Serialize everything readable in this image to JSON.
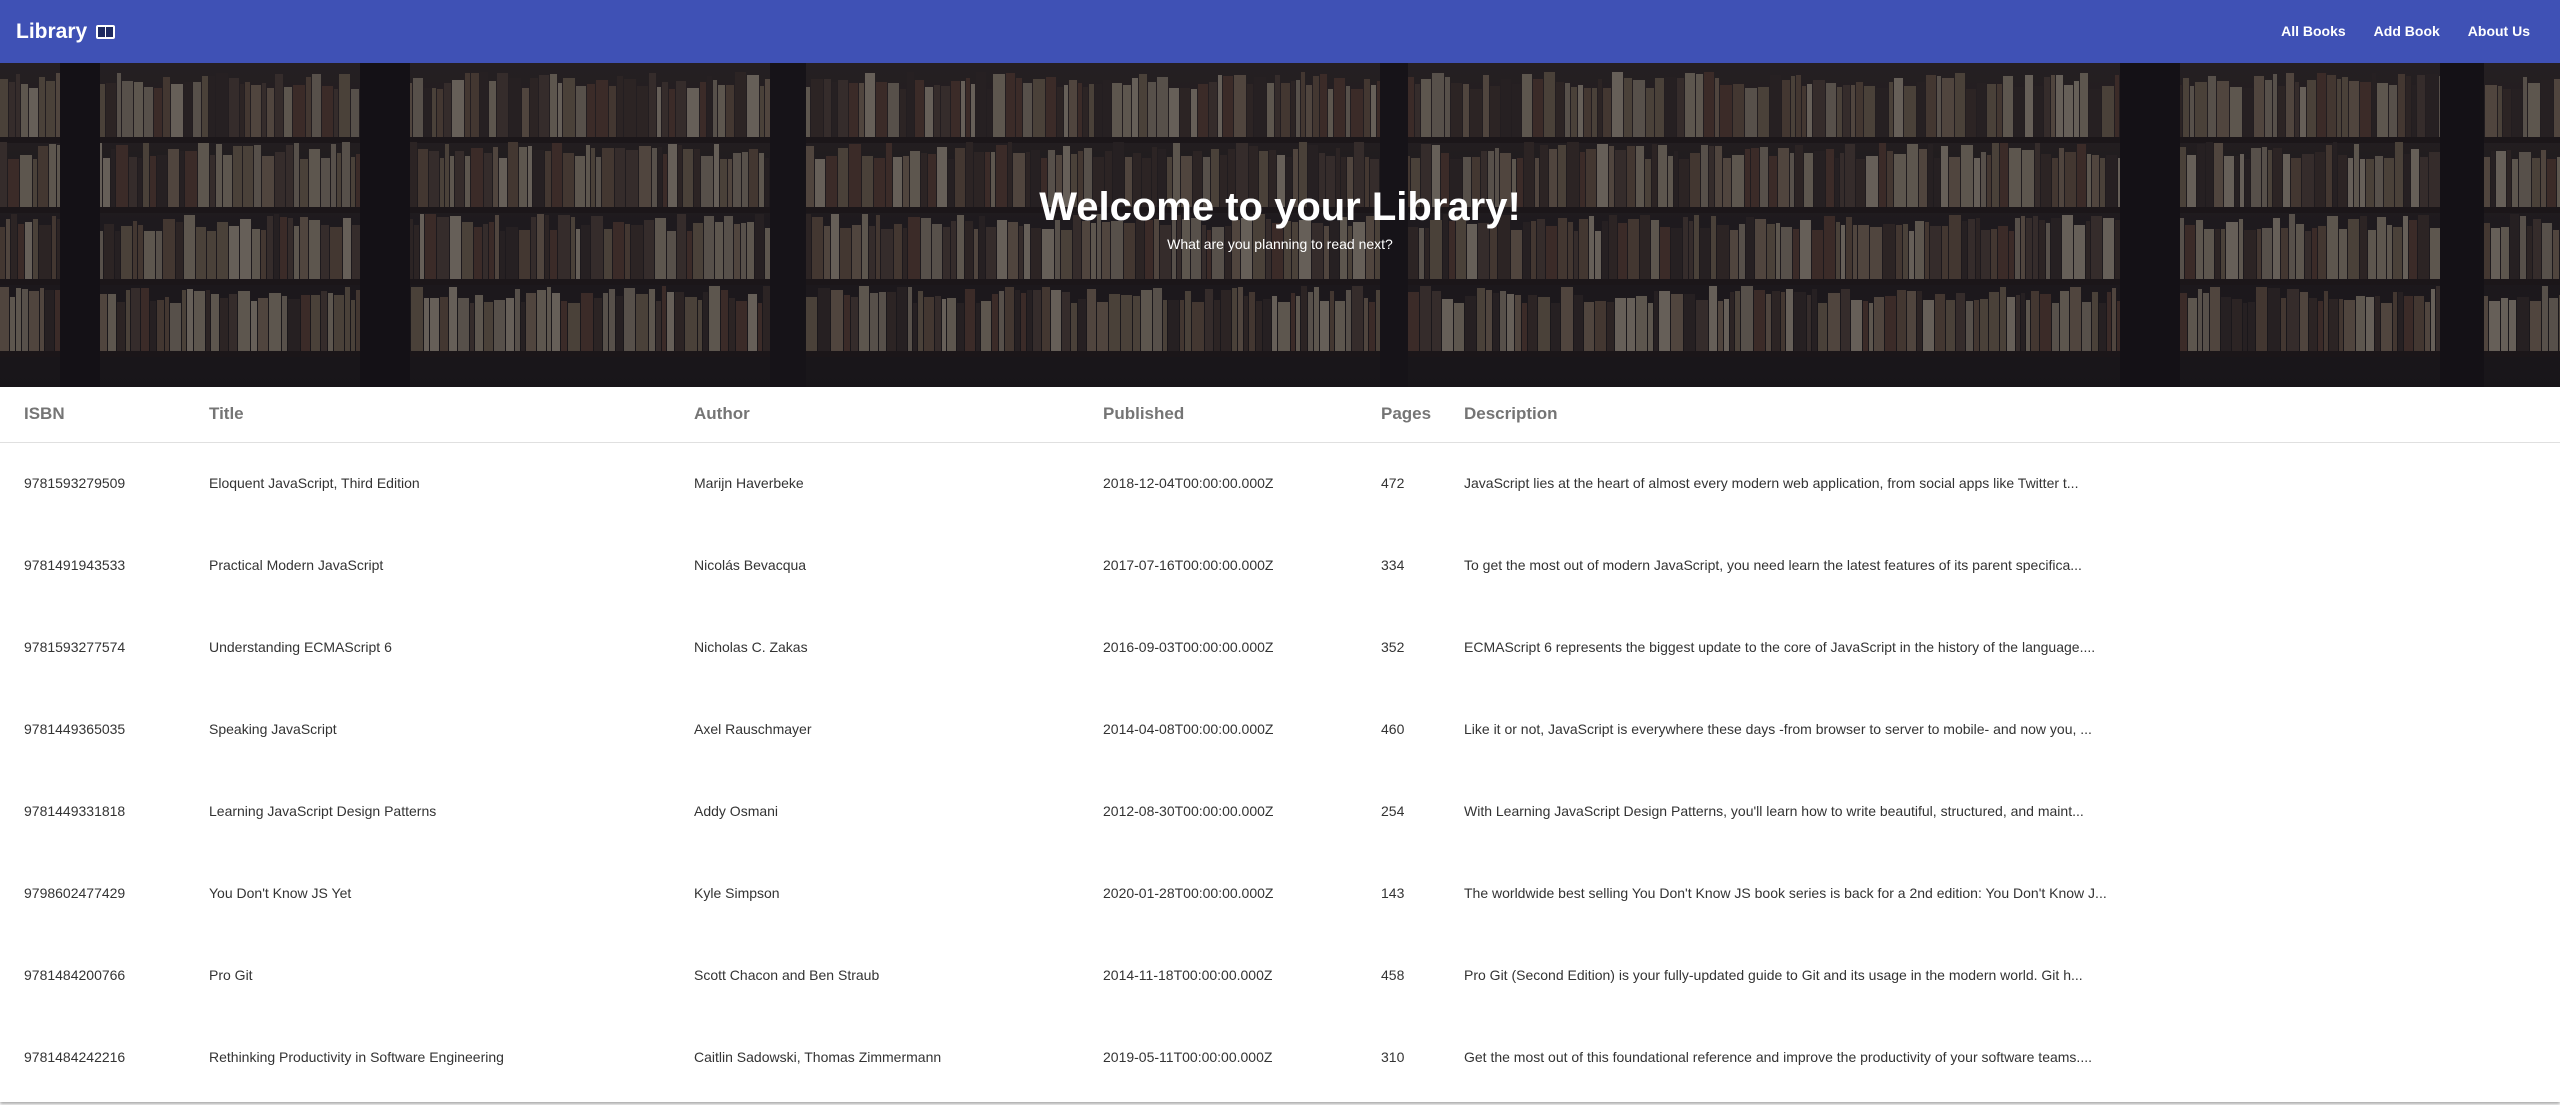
{
  "navbar": {
    "brand": "Library",
    "links": [
      "All Books",
      "Add Book",
      "About Us"
    ],
    "color": "#3f51b5"
  },
  "hero": {
    "title": "Welcome to your Library!",
    "subtitle": "What are you planning to read next?"
  },
  "table": {
    "headers": [
      "ISBN",
      "Title",
      "Author",
      "Published",
      "Pages",
      "Description"
    ],
    "rows": [
      [
        "9781593279509",
        "Eloquent JavaScript, Third Edition",
        "Marijn Haverbeke",
        "2018-12-04T00:00:00.000Z",
        "472",
        "JavaScript lies at the heart of almost every modern web application, from social apps like Twitter t..."
      ],
      [
        "9781491943533",
        "Practical Modern JavaScript",
        "Nicolás Bevacqua",
        "2017-07-16T00:00:00.000Z",
        "334",
        "To get the most out of modern JavaScript, you need learn the latest features of its parent specifica..."
      ],
      [
        "9781593277574",
        "Understanding ECMAScript 6",
        "Nicholas C. Zakas",
        "2016-09-03T00:00:00.000Z",
        "352",
        "ECMAScript 6 represents the biggest update to the core of JavaScript in the history of the language...."
      ],
      [
        "9781449365035",
        "Speaking JavaScript",
        "Axel Rauschmayer",
        "2014-04-08T00:00:00.000Z",
        "460",
        "Like it or not, JavaScript is everywhere these days -from browser to server to mobile- and now you, ..."
      ],
      [
        "9781449331818",
        "Learning JavaScript Design Patterns",
        "Addy Osmani",
        "2012-08-30T00:00:00.000Z",
        "254",
        "With Learning JavaScript Design Patterns, you'll learn how to write beautiful, structured, and maint..."
      ],
      [
        "9798602477429",
        "You Don't Know JS Yet",
        "Kyle Simpson",
        "2020-01-28T00:00:00.000Z",
        "143",
        "The worldwide best selling You Don't Know JS book series is back for a 2nd edition: You Don't Know J..."
      ],
      [
        "9781484200766",
        "Pro Git",
        "Scott Chacon and Ben Straub",
        "2014-11-18T00:00:00.000Z",
        "458",
        "Pro Git (Second Edition) is your fully-updated guide to Git and its usage in the modern world. Git h..."
      ],
      [
        "9781484242216",
        "Rethinking Productivity in Software Engineering",
        "Caitlin Sadowski, Thomas Zimmermann",
        "2019-05-11T00:00:00.000Z",
        "310",
        "Get the most out of this foundational reference and improve the productivity of your software teams...."
      ]
    ]
  }
}
